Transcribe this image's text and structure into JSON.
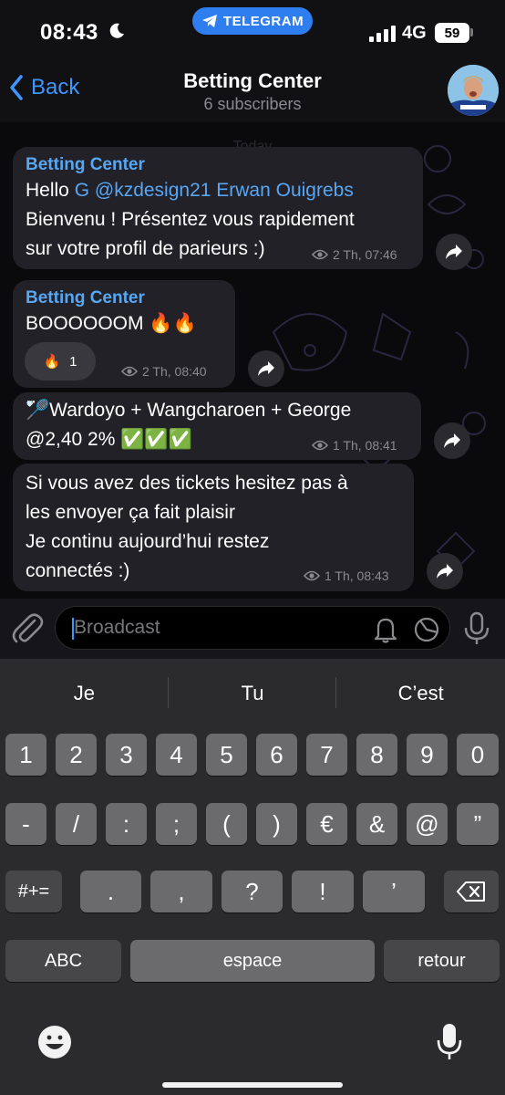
{
  "status": {
    "time": "08:43",
    "app_pill": "TELEGRAM",
    "network": "4G",
    "battery": "59"
  },
  "header": {
    "back_label": "Back",
    "title": "Betting Center",
    "subtitle": "6 subscribers"
  },
  "chat": {
    "date_label": "Today",
    "messages": [
      {
        "sender": "Betting Center",
        "line1_prefix": "Hello ",
        "line1_mention": "G @kzdesign21 Erwan Ouigrebs",
        "line2": "Bienvenu ! Présentez vous rapidement",
        "line3": "sur votre profil de parieurs :)",
        "views": "2 Th, 07:46"
      },
      {
        "sender": "Betting Center",
        "text": "BOOOOOOM 🔥🔥",
        "reaction_emoji": "🔥",
        "reaction_count": "1",
        "views": "2 Th, 08:40"
      },
      {
        "line1": "🏸Wardoyo + Wangcharoen + George",
        "line2": "@2,40 2% ✅✅✅",
        "views": "1 Th, 08:41"
      },
      {
        "line1": "Si vous avez des tickets hesitez pas à",
        "line2": "les envoyer ça fait plaisir",
        "line3": "Je continu aujourd’hui restez",
        "line4": "connectés :)",
        "views": "1 Th, 08:43"
      }
    ]
  },
  "input": {
    "placeholder": "Broadcast"
  },
  "keyboard": {
    "suggestions": [
      "Je",
      "Tu",
      "C’est"
    ],
    "row1": [
      "1",
      "2",
      "3",
      "4",
      "5",
      "6",
      "7",
      "8",
      "9",
      "0"
    ],
    "row2": [
      "-",
      "/",
      ":",
      ";",
      "(",
      ")",
      "€",
      "&",
      "@",
      "”"
    ],
    "row3_toggle": "#+=",
    "row3": [
      ".",
      ",",
      "?",
      "!",
      "’"
    ],
    "abc_label": "ABC",
    "space_label": "espace",
    "return_label": "retour"
  },
  "colors": {
    "accent": "#3e96ff",
    "telegram_pill": "#2f7ef0",
    "bubble": "#222127"
  }
}
